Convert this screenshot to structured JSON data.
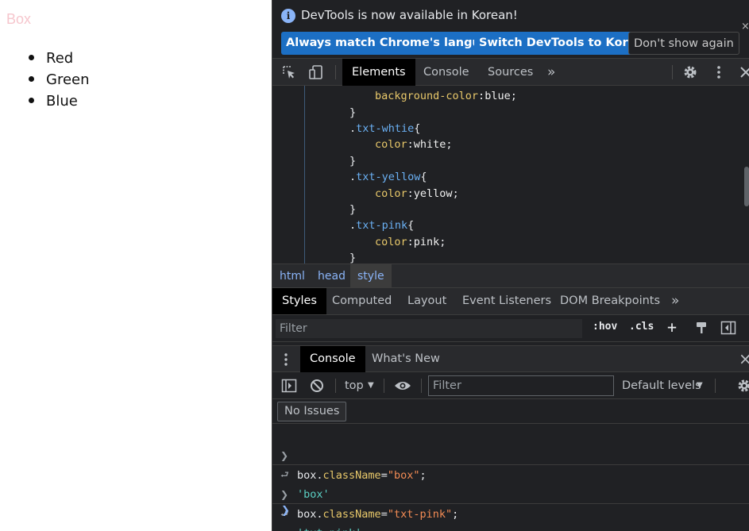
{
  "page": {
    "title": "Box",
    "list": [
      "Red",
      "Green",
      "Blue"
    ]
  },
  "infobar": {
    "message": "DevTools is now available in Korean!",
    "btn_match": "Always match Chrome's language",
    "btn_switch": "Switch DevTools to Korean",
    "btn_dismiss": "Don't show again",
    "close": "×"
  },
  "tabs": {
    "elements": "Elements",
    "console": "Console",
    "sources": "Sources",
    "more": "»"
  },
  "code": {
    "lines": [
      {
        "kind": "prop",
        "prop": "background-color",
        "value": "blue"
      },
      {
        "kind": "close",
        "text": "}"
      },
      {
        "kind": "sel",
        "text": ".txt-whtie{"
      },
      {
        "kind": "prop",
        "prop": "color",
        "value": "white"
      },
      {
        "kind": "close",
        "text": "}"
      },
      {
        "kind": "sel",
        "text": ".txt-yellow{"
      },
      {
        "kind": "prop",
        "prop": "color",
        "value": "yellow"
      },
      {
        "kind": "close",
        "text": "}"
      },
      {
        "kind": "sel",
        "text": ".txt-pink{"
      },
      {
        "kind": "prop",
        "prop": "color",
        "value": "pink"
      },
      {
        "kind": "close",
        "text": "}"
      }
    ]
  },
  "breadcrumbs": [
    "html",
    "head",
    "style"
  ],
  "subtabs": {
    "styles": "Styles",
    "computed": "Computed",
    "layout": "Layout",
    "listeners": "Event Listeners",
    "dom_breakpoints": "DOM Breakpoints",
    "more": "»"
  },
  "filterbar": {
    "placeholder": "Filter",
    "hov": ":hov",
    "cls": ".cls",
    "plus": "+"
  },
  "drawer": {
    "console": "Console",
    "whats_new": "What's New",
    "close": "×"
  },
  "console_toolbar": {
    "context": "top",
    "filter_placeholder": "Filter",
    "levels": "Default levels"
  },
  "issues": {
    "label": "No Issues"
  },
  "console_log": [
    {
      "type": "input",
      "obj": "box",
      "prop": "className",
      "str": "\"box\"",
      "end": ";"
    },
    {
      "type": "output",
      "result": "'box'"
    },
    {
      "type": "input",
      "obj": "box",
      "prop": "className",
      "str": "\"txt-pink\"",
      "end": ";"
    },
    {
      "type": "output",
      "result": "'txt-pink'"
    }
  ],
  "colors": {
    "accent": "#1c6fc4",
    "link": "#8ab4f8",
    "selector": "#6ab0f3",
    "property": "#e8c86a",
    "string": "#f28b54",
    "result": "#5bd0c4"
  }
}
